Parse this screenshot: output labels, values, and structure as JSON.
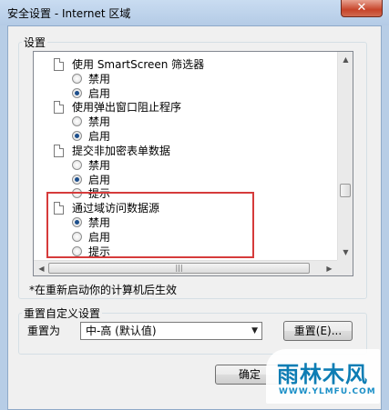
{
  "window": {
    "title": "安全设置 - Internet 区域",
    "close_symbol": "✕"
  },
  "settings": {
    "group_label": "设置",
    "items": [
      {
        "label": "使用 SmartScreen 筛选器",
        "options": [
          {
            "label": "禁用",
            "checked": false
          },
          {
            "label": "启用",
            "checked": true
          }
        ]
      },
      {
        "label": "使用弹出窗口阻止程序",
        "options": [
          {
            "label": "禁用",
            "checked": false
          },
          {
            "label": "启用",
            "checked": true
          }
        ]
      },
      {
        "label": "提交非加密表单数据",
        "options": [
          {
            "label": "禁用",
            "checked": false
          },
          {
            "label": "启用",
            "checked": true
          },
          {
            "label": "提示",
            "checked": false
          }
        ]
      },
      {
        "label": "通过域访问数据源",
        "options": [
          {
            "label": "禁用",
            "checked": true
          },
          {
            "label": "启用",
            "checked": false
          },
          {
            "label": "提示",
            "checked": false
          }
        ]
      }
    ]
  },
  "note": "*在重新启动你的计算机后生效",
  "reset": {
    "group_label": "重置自定义设置",
    "reset_to_label": "重置为",
    "selected_level": "中-高 (默认值)",
    "reset_button": "重置(E)..."
  },
  "footer": {
    "ok_button": "确定"
  },
  "watermark": {
    "main": "雨林木风",
    "sub": "WWW.YLMFU.COM"
  },
  "colors": {
    "highlight_border": "#d63b3b",
    "watermark": "#0d7db4"
  }
}
